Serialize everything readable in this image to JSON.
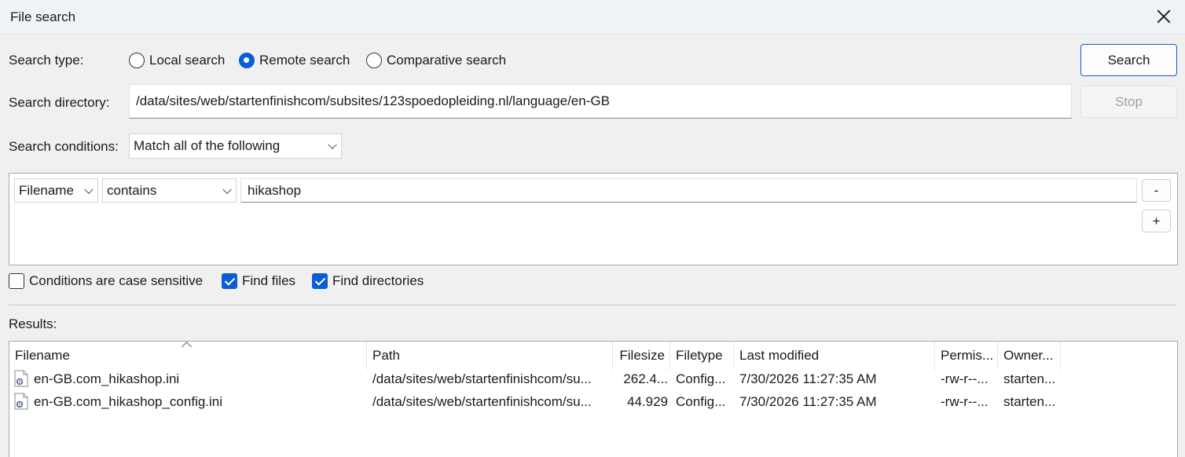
{
  "window": {
    "title": "File search"
  },
  "search_type": {
    "label": "Search type:",
    "options": [
      {
        "label": "Local search",
        "checked": false
      },
      {
        "label": "Remote search",
        "checked": true
      },
      {
        "label": "Comparative search",
        "checked": false
      }
    ]
  },
  "buttons": {
    "search": "Search",
    "stop": "Stop",
    "remove": "-",
    "add": "+"
  },
  "search_directory": {
    "label": "Search directory:",
    "value": "/data/sites/web/startenfinishcom/subsites/123spoedopleiding.nl/language/en-GB"
  },
  "search_conditions": {
    "label": "Search conditions:",
    "selected": "Match all of the following"
  },
  "condition": {
    "field": "Filename",
    "operator": "contains",
    "value": "hikashop"
  },
  "options": {
    "case_sensitive": {
      "label": "Conditions are case sensitive",
      "checked": false
    },
    "find_files": {
      "label": "Find files",
      "checked": true
    },
    "find_directories": {
      "label": "Find directories",
      "checked": true
    }
  },
  "results": {
    "label": "Results:",
    "columns": [
      "Filename",
      "Path",
      "Filesize",
      "Filetype",
      "Last modified",
      "Permis...",
      "Owner..."
    ],
    "rows": [
      {
        "filename": "en-GB.com_hikashop.ini",
        "path": "/data/sites/web/startenfinishcom/su...",
        "filesize": "262.4...",
        "filetype": "Config...",
        "modified": "7/30/2026 11:27:35 AM",
        "permissions": "-rw-r--...",
        "owner": "starten..."
      },
      {
        "filename": "en-GB.com_hikashop_config.ini",
        "path": "/data/sites/web/startenfinishcom/su...",
        "filesize": "44.929",
        "filetype": "Config...",
        "modified": "7/30/2026 11:27:35 AM",
        "permissions": "-rw-r--...",
        "owner": "starten..."
      }
    ]
  },
  "colors": {
    "accent": "#0b5cd5",
    "titlebar": "#eef3f8"
  }
}
